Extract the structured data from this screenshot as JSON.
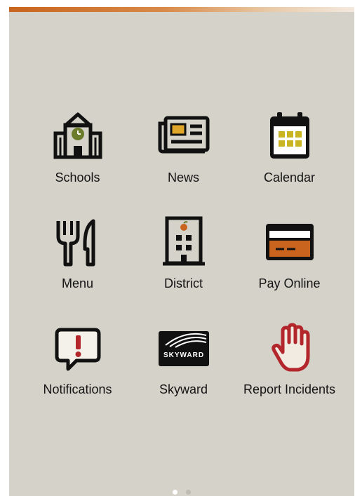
{
  "colors": {
    "background": "#d4d2c9",
    "accent": "#c8641e",
    "icon_dark": "#111111",
    "calendar_tile": "#c8b521",
    "card_stripe": "#c8641e",
    "hand": "#b2262c",
    "dot_active": "#ffffff",
    "dot_inactive": "#bdbbb2"
  },
  "tiles": [
    {
      "label": "Schools",
      "icon": "school-building-icon"
    },
    {
      "label": "News",
      "icon": "newspaper-icon"
    },
    {
      "label": "Calendar",
      "icon": "calendar-icon"
    },
    {
      "label": "Menu",
      "icon": "fork-knife-icon"
    },
    {
      "label": "District",
      "icon": "district-building-icon"
    },
    {
      "label": "Pay Online",
      "icon": "credit-card-icon"
    },
    {
      "label": "Notifications",
      "icon": "alert-speech-bubble-icon"
    },
    {
      "label": "Skyward",
      "icon": "skyward-logo-icon",
      "logo_text": "SKYWARD"
    },
    {
      "label": "Report Incidents",
      "icon": "raised-hand-icon"
    }
  ],
  "pager": {
    "pages": 2,
    "current": 1
  }
}
